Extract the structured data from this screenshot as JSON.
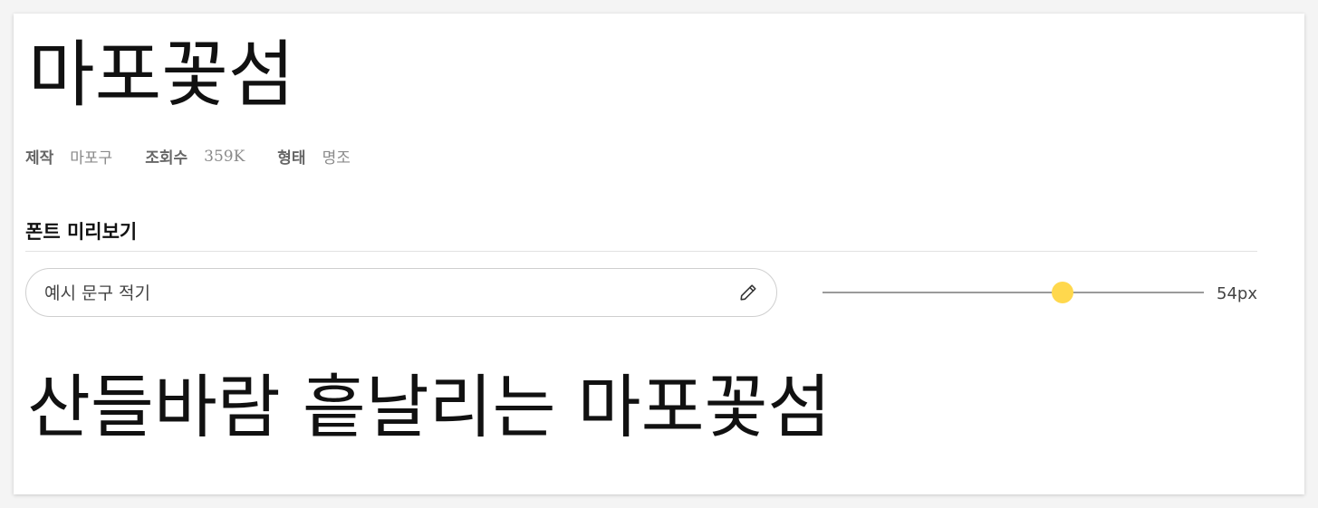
{
  "font": {
    "name": "마포꽃섬",
    "meta": [
      {
        "label": "제작",
        "value": "마포구"
      },
      {
        "label": "조회수",
        "value": "359K"
      },
      {
        "label": "형태",
        "value": "명조"
      }
    ]
  },
  "preview": {
    "heading": "폰트 미리보기",
    "input_placeholder": "예시 문구 적기",
    "input_value": "",
    "edit_icon": "pencil-icon",
    "size_label": "54px",
    "size_slider_level": 0.63,
    "sample_text": "산들바람 흩날리는 마포꽃섬"
  },
  "colors": {
    "slider_thumb": "#ffd84d",
    "slider_track": "#9a9a9a"
  }
}
